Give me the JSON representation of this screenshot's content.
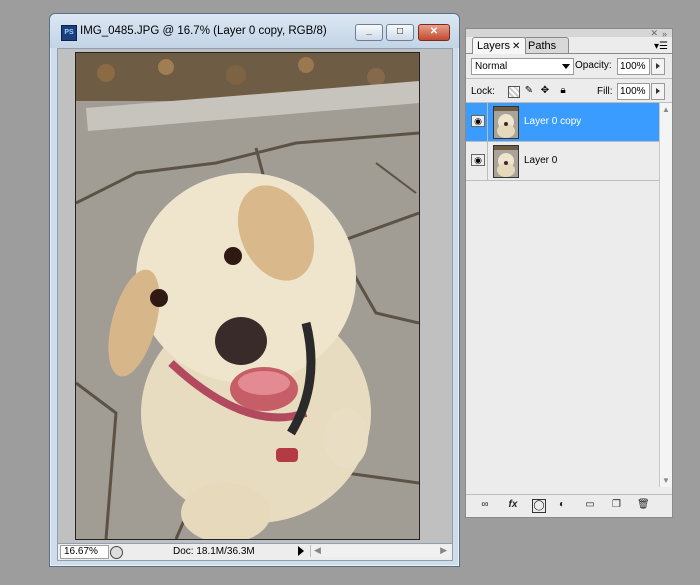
{
  "document_window": {
    "app_icon": "PS",
    "title": "IMG_0485.JPG @ 16.7% (Layer 0 copy, RGB/8)",
    "buttons": {
      "minimize": "minimize-icon",
      "maximize": "maximize-icon",
      "close": "close-icon"
    },
    "status": {
      "zoom": "16.67%",
      "doc_info": "Doc: 18.1M/36.3M"
    }
  },
  "layers_panel": {
    "tabs": [
      {
        "label": "Layers",
        "active": true
      },
      {
        "label": "Paths",
        "active": false
      }
    ],
    "blend_mode": "Normal",
    "opacity_label": "Opacity:",
    "opacity_value": "100%",
    "lock_label": "Lock:",
    "fill_label": "Fill:",
    "fill_value": "100%",
    "layers": [
      {
        "name": "Layer 0 copy",
        "visible": true,
        "selected": true
      },
      {
        "name": "Layer 0",
        "visible": true,
        "selected": false
      }
    ],
    "footer_icons": [
      "link-layers-icon",
      "fx-icon",
      "layer-mask-icon",
      "adjustment-layer-icon",
      "new-group-icon",
      "new-layer-icon",
      "trash-icon"
    ]
  },
  "colors": {
    "selected_layer": "#3b9cff",
    "desktop": "#9d9d9d",
    "close_button": "#c24a2f"
  }
}
